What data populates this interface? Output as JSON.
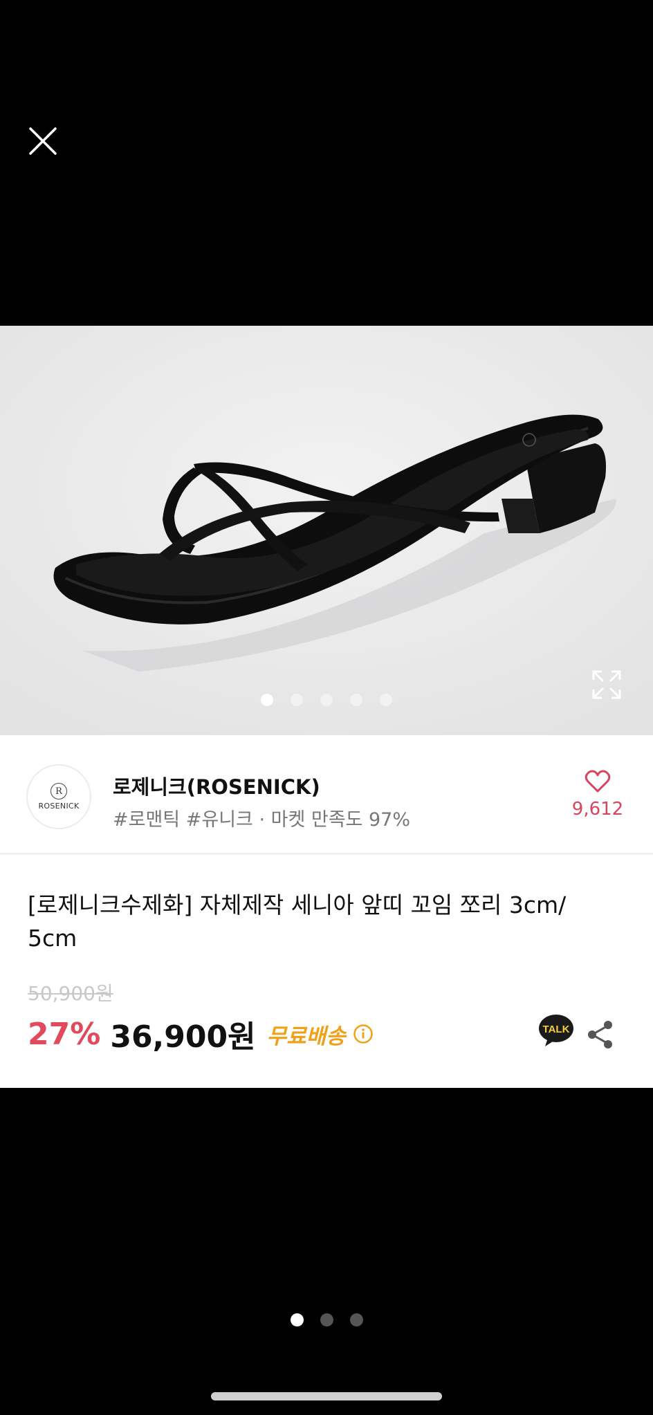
{
  "screen": {
    "close_icon": "close-icon",
    "page_indicator": {
      "count": 3,
      "active": 0
    }
  },
  "product_image": {
    "alt": "",
    "expand_icon": "expand-icon",
    "dots": {
      "count": 5,
      "active": 0
    }
  },
  "store": {
    "name": "로제니크(ROSENICK)",
    "tags": "#로맨틱 #유니크 · 마켓 만족도 97%",
    "logo_monogram": "R",
    "logo_text": "ROSENICK",
    "like_count": "9,612",
    "heart_icon": "heart-outline-icon"
  },
  "product": {
    "title": "[로제니크수제화] 자체제작 세니아 앞띠 꼬임 쪼리 3cm/ 5cm",
    "original_price": "50,900원",
    "discount_rate": "27%",
    "price": "36,900원",
    "shipping": "무료배송",
    "talk_label": "TALK",
    "share_icon": "share-icon",
    "info_icon": "info-icon"
  },
  "colors": {
    "accent_red": "#e14a5c",
    "like_red": "#d6455d",
    "shipping_orange": "#f0a019",
    "kakao_yellow": "#f7cf30"
  }
}
